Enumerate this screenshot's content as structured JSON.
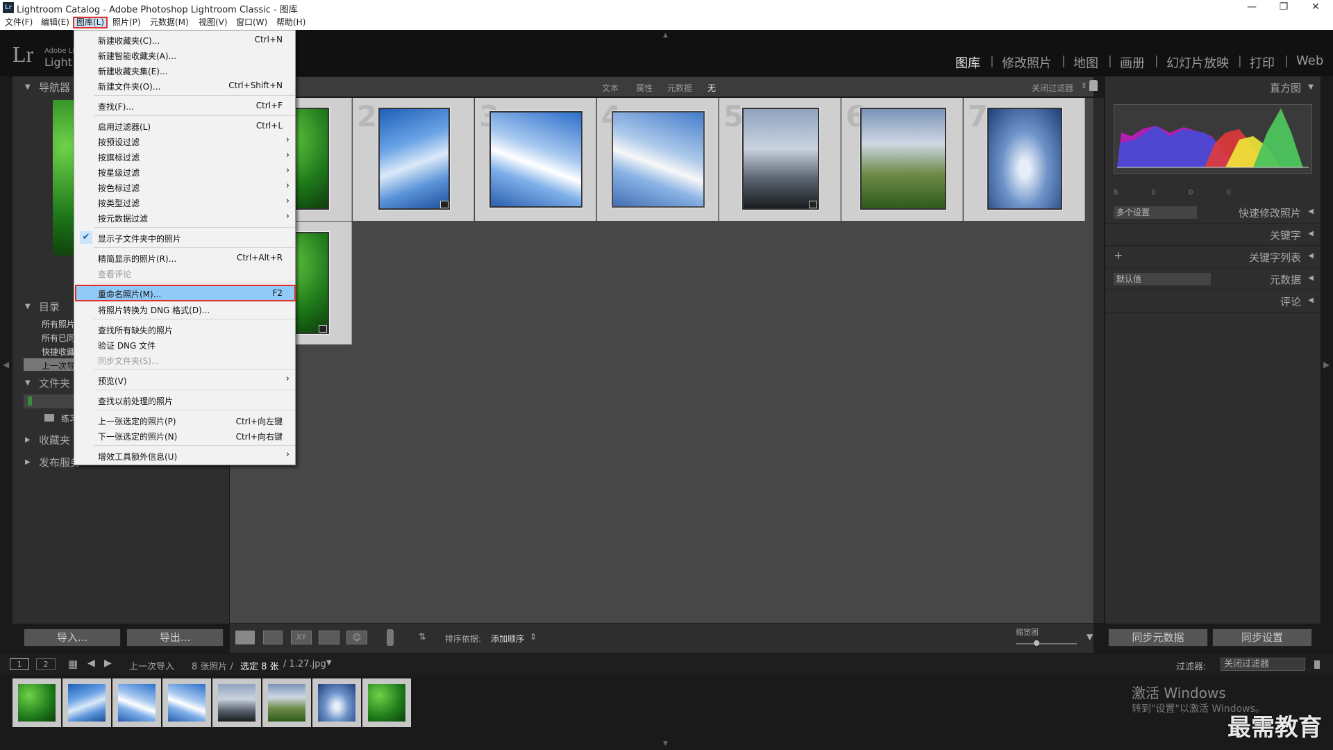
{
  "titlebar": {
    "icon": "Lr",
    "title": "Lightroom Catalog - Adobe Photoshop Lightroom Classic - 图库"
  },
  "menubar": [
    "文件(F)",
    "编辑(E)",
    "图库(L)",
    "照片(P)",
    "元数据(M)",
    "视图(V)",
    "窗口(W)",
    "帮助(H)"
  ],
  "brand": {
    "logo": "Lr",
    "line1": "Adobe Li",
    "line2": "Light"
  },
  "modules": [
    "图库",
    "修改照片",
    "地图",
    "画册",
    "幻灯片放映",
    "打印",
    "Web"
  ],
  "left_panel": {
    "navigator": "导航器",
    "catalog": "目录",
    "catalog_items": [
      "所有照片",
      "所有已同",
      "快捷收藏",
      "上一次导"
    ],
    "folders": "文件夹",
    "folder_item": "练习",
    "collections": "收藏夹",
    "publish": "发布服务",
    "import_btn": "导入...",
    "export_btn": "导出..."
  },
  "filter_bar": {
    "text": "文本",
    "attribute": "属性",
    "metadata": "元数据",
    "none": "无",
    "filter_off": "关闭过滤器"
  },
  "grid": {
    "numbers": [
      "2",
      "3",
      "4",
      "5",
      "6",
      "7"
    ]
  },
  "toolbar": {
    "sort_label": "排序依据:",
    "sort_value": "添加顺序",
    "thumb_label": "缩览图"
  },
  "right_panel": {
    "histogram": "直方图",
    "quick_develop": "快速修改照片",
    "quick_preset": "多个设置",
    "keywords": "关键字",
    "keyword_list": "关键字列表",
    "metadata": "元数据",
    "metadata_preset": "默认值",
    "comments": "评论",
    "sync_metadata": "同步元数据",
    "sync_settings": "同步设置",
    "histo_stats": [
      "8",
      "0",
      "0",
      "0"
    ]
  },
  "filmstrip": {
    "page1": "1",
    "page2": "2",
    "source": "上一次导入",
    "count": "8 张照片 /",
    "selected": "选定 8 张",
    "file": "/ 1.27.jpg",
    "filter_label": "过滤器:",
    "filter_value": "关闭过滤器"
  },
  "menu": {
    "items": [
      {
        "label": "新建收藏夹(C)...",
        "shortcut": "Ctrl+N"
      },
      {
        "label": "新建智能收藏夹(A)...",
        "shortcut": ""
      },
      {
        "label": "新建收藏夹集(E)...",
        "shortcut": ""
      },
      {
        "label": "新建文件夹(O)...",
        "shortcut": "Ctrl+Shift+N"
      },
      {
        "label": "查找(F)...",
        "shortcut": "Ctrl+F"
      },
      {
        "label": "启用过滤器(L)",
        "shortcut": "Ctrl+L"
      },
      {
        "label": "按预设过滤",
        "shortcut": ""
      },
      {
        "label": "按旗标过滤",
        "shortcut": ""
      },
      {
        "label": "按星级过滤",
        "shortcut": ""
      },
      {
        "label": "按色标过滤",
        "shortcut": ""
      },
      {
        "label": "按类型过滤",
        "shortcut": ""
      },
      {
        "label": "按元数据过滤",
        "shortcut": ""
      },
      {
        "label": "显示子文件夹中的照片",
        "shortcut": ""
      },
      {
        "label": "精简显示的照片(R)...",
        "shortcut": "Ctrl+Alt+R"
      },
      {
        "label": "查看评论",
        "shortcut": ""
      },
      {
        "label": "重命名照片(M)...",
        "shortcut": "F2"
      },
      {
        "label": "将照片转换为 DNG 格式(D)...",
        "shortcut": ""
      },
      {
        "label": "查找所有缺失的照片",
        "shortcut": ""
      },
      {
        "label": "验证 DNG 文件",
        "shortcut": ""
      },
      {
        "label": "同步文件夹(S)...",
        "shortcut": ""
      },
      {
        "label": "预览(V)",
        "shortcut": ""
      },
      {
        "label": "查找以前处理的照片",
        "shortcut": ""
      },
      {
        "label": "上一张选定的照片(P)",
        "shortcut": "Ctrl+向左键"
      },
      {
        "label": "下一张选定的照片(N)",
        "shortcut": "Ctrl+向右键"
      },
      {
        "label": "增效工具额外信息(U)",
        "shortcut": ""
      }
    ]
  },
  "os_notice": {
    "line1": "激活 Windows",
    "line2": "转到\"设置\"以激活 Windows。"
  },
  "watermark": "最需教育"
}
